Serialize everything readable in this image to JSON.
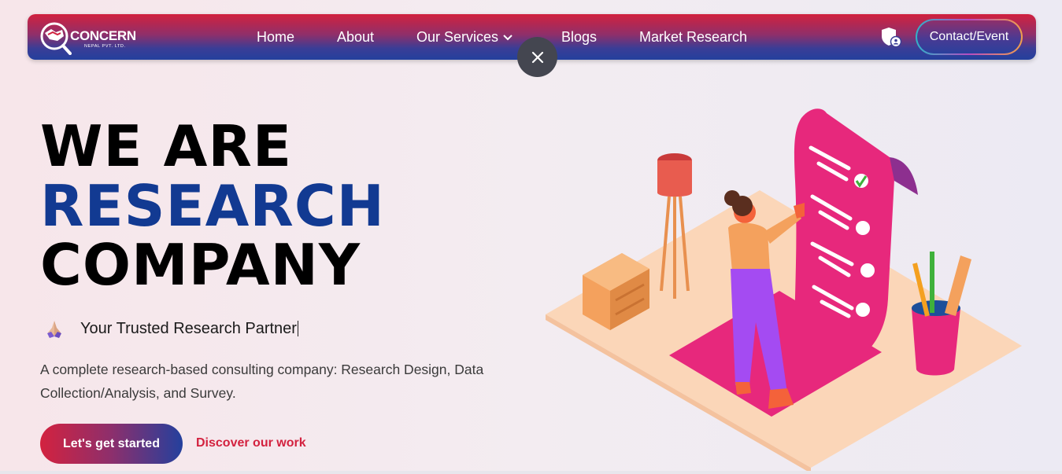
{
  "brand": {
    "name": "CONCERN",
    "subtitle": "NEPAL PVT. LTD."
  },
  "nav": {
    "items": [
      {
        "label": "Home"
      },
      {
        "label": "About"
      },
      {
        "label": "Our Services"
      },
      {
        "label": "Blogs"
      },
      {
        "label": "Market Research"
      }
    ],
    "contact_label": "Contact/Event"
  },
  "hero": {
    "line1": "WE ARE",
    "line2": "RESEARCH",
    "line3": "COMPANY",
    "tagline": "Your Trusted Research Partner",
    "description": "A complete research-based consulting company: Research Design, Data Collection/Analysis, and Survey.",
    "primary_cta": "Let's get started",
    "secondary_cta": "Discover our work"
  },
  "colors": {
    "brand_red": "#d3223f",
    "brand_blue": "#123a92",
    "illustration_pink": "#e7287c"
  },
  "icons": {
    "close": "close-icon",
    "shield": "shield-user-icon",
    "dropdown": "chevron-down-icon"
  }
}
